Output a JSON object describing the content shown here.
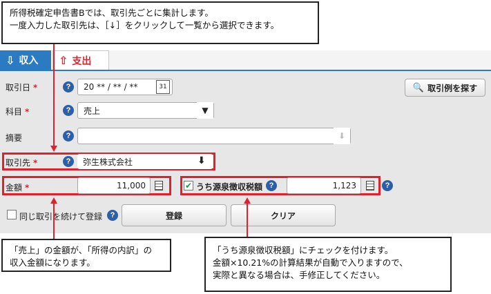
{
  "callouts": {
    "top_line1": "所得税確定申告書Bでは、取引先ごとに集計します。",
    "top_line2": "一度入力した取引先は、［↓］をクリックして一覧から選択できます。",
    "bottom_left_line1": "「売上」の金額が、「所得の内訳」の",
    "bottom_left_line2": "収入金額になります。",
    "bottom_right_line1": "「うち源泉徴収税額」にチェックを付けます。",
    "bottom_right_line2": "金額×10.21%の計算結果が自動で入りますので、",
    "bottom_right_line3": "実際と異なる場合は、手修正してください。"
  },
  "tabs": {
    "income": "収入",
    "expense": "支出"
  },
  "form": {
    "date_label": "取引日",
    "date_value": "20 ** / ** / **",
    "find_example_button": "取引例を探す",
    "account_label": "科目",
    "account_value": "売上",
    "summary_label": "摘要",
    "summary_value": "",
    "partner_label": "取引先",
    "partner_value": "弥生株式会社",
    "amount_label": "金額",
    "amount_value": "11,000",
    "withholding_label": "うち源泉徴収税額",
    "withholding_value": "1,123",
    "withholding_checked": true,
    "repeat_label": "同じ取引を続けて登録",
    "register_button": "登録",
    "clear_button": "クリア",
    "required_mark": "*",
    "help_mark": "?"
  },
  "colors": {
    "accent_blue": "#2b7bc3",
    "highlight_red": "#e0212b",
    "expense_red": "#d8262e"
  }
}
